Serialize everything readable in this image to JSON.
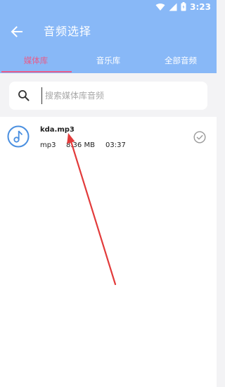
{
  "status_bar": {
    "time": "3:23",
    "icons": [
      "wifi-icon",
      "signal-icon",
      "battery-icon"
    ]
  },
  "toolbar": {
    "back_icon": "arrow-left-icon",
    "title": "音频选择"
  },
  "tabs": [
    {
      "label": "媒体库",
      "active": true
    },
    {
      "label": "音乐库",
      "active": false
    },
    {
      "label": "全部音频",
      "active": false
    }
  ],
  "search": {
    "placeholder": "搜索媒体库音频",
    "value": "",
    "icon": "search-icon"
  },
  "files": [
    {
      "name": "kda.mp3",
      "format": "mp3",
      "size": "8.36 MB",
      "duration": "03:37",
      "icon": "music-note-icon",
      "selected": false
    }
  ],
  "colors": {
    "header": "#88b8f7",
    "accent": "#e85c8a",
    "icon_blue": "#4a8fe0",
    "annotation": "#e23b3b"
  }
}
